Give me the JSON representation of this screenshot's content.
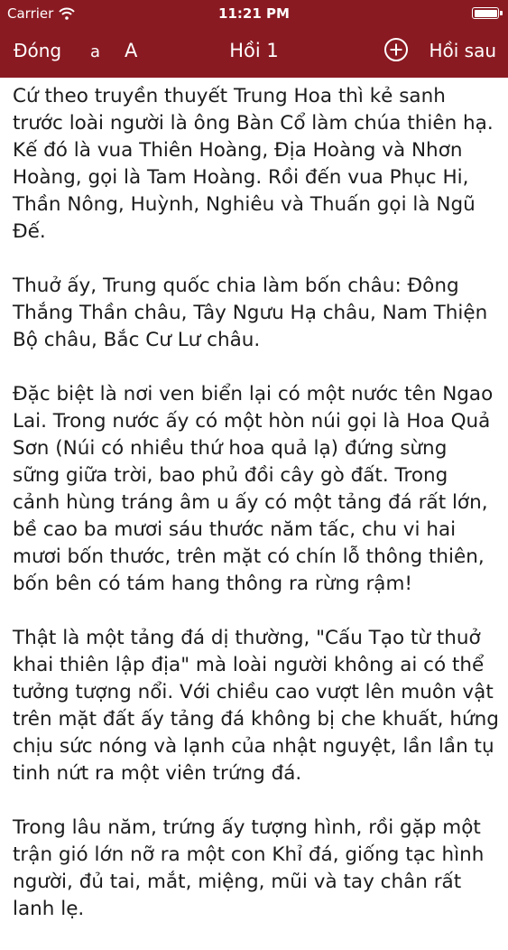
{
  "status": {
    "carrier": "Carrier",
    "time": "11:21 PM"
  },
  "nav": {
    "close_label": "Đóng",
    "font_small": "a",
    "font_large": "A",
    "title": "Hồi 1",
    "next_label": "Hồi sau"
  },
  "colors": {
    "bar": "#8a1a22",
    "text": "#1c1c1c"
  },
  "content": {
    "paragraphs": [
      "Cứ theo truyền thuyết Trung Hoa thì kẻ sanh trước loài người là ông Bàn Cổ làm chúa thiên hạ. Kế đó là vua Thiên Hoàng, Địa Hoàng và Nhơn Hoàng, gọi là Tam Hoàng. Rồi đến vua Phục Hi, Thần Nông, Huỳnh, Nghiêu và Thuấn gọi là Ngũ Đế.",
      "Thuở ấy, Trung quốc chia làm bốn châu: Đông Thắng Thần châu, Tây Ngưu Hạ châu, Nam Thiện Bộ châu, Bắc Cư Lư châu.",
      "Đặc biệt là nơi ven biển lại có một nước tên Ngao Lai. Trong nước ấy có một hòn núi gọi là Hoa Quả Sơn (Núi có nhiều thứ hoa quả lạ) đứng sừng sững giữa trời, bao phủ đồi cây gò đất. Trong cảnh hùng tráng âm u ấy có một tảng đá rất lớn, bề cao ba mươi sáu thước năm tấc, chu vi hai mươi bốn thước, trên mặt có chín lỗ thông thiên, bốn bên có tám hang thông ra rừng rậm!",
      "Thật là một tảng đá dị thường, \"Cấu Tạo từ thuở khai thiên lập địa\" mà loài người không ai có thể tưởng tượng nổi. Với chiều cao vượt lên muôn vật trên mặt đất ấy tảng đá không bị che khuất, hứng chịu sức nóng và lạnh của nhật nguyệt, lần lần tụ tinh nứt ra một viên trứng đá.",
      "Trong lâu năm, trứng ấy tượng hình, rồi gặp một trận gió lớn nỡ ra một con Khỉ đá, giống tạc hình người, đủ tai, mắt, miệng, mũi và tay chân rất lanh lẹ."
    ]
  }
}
